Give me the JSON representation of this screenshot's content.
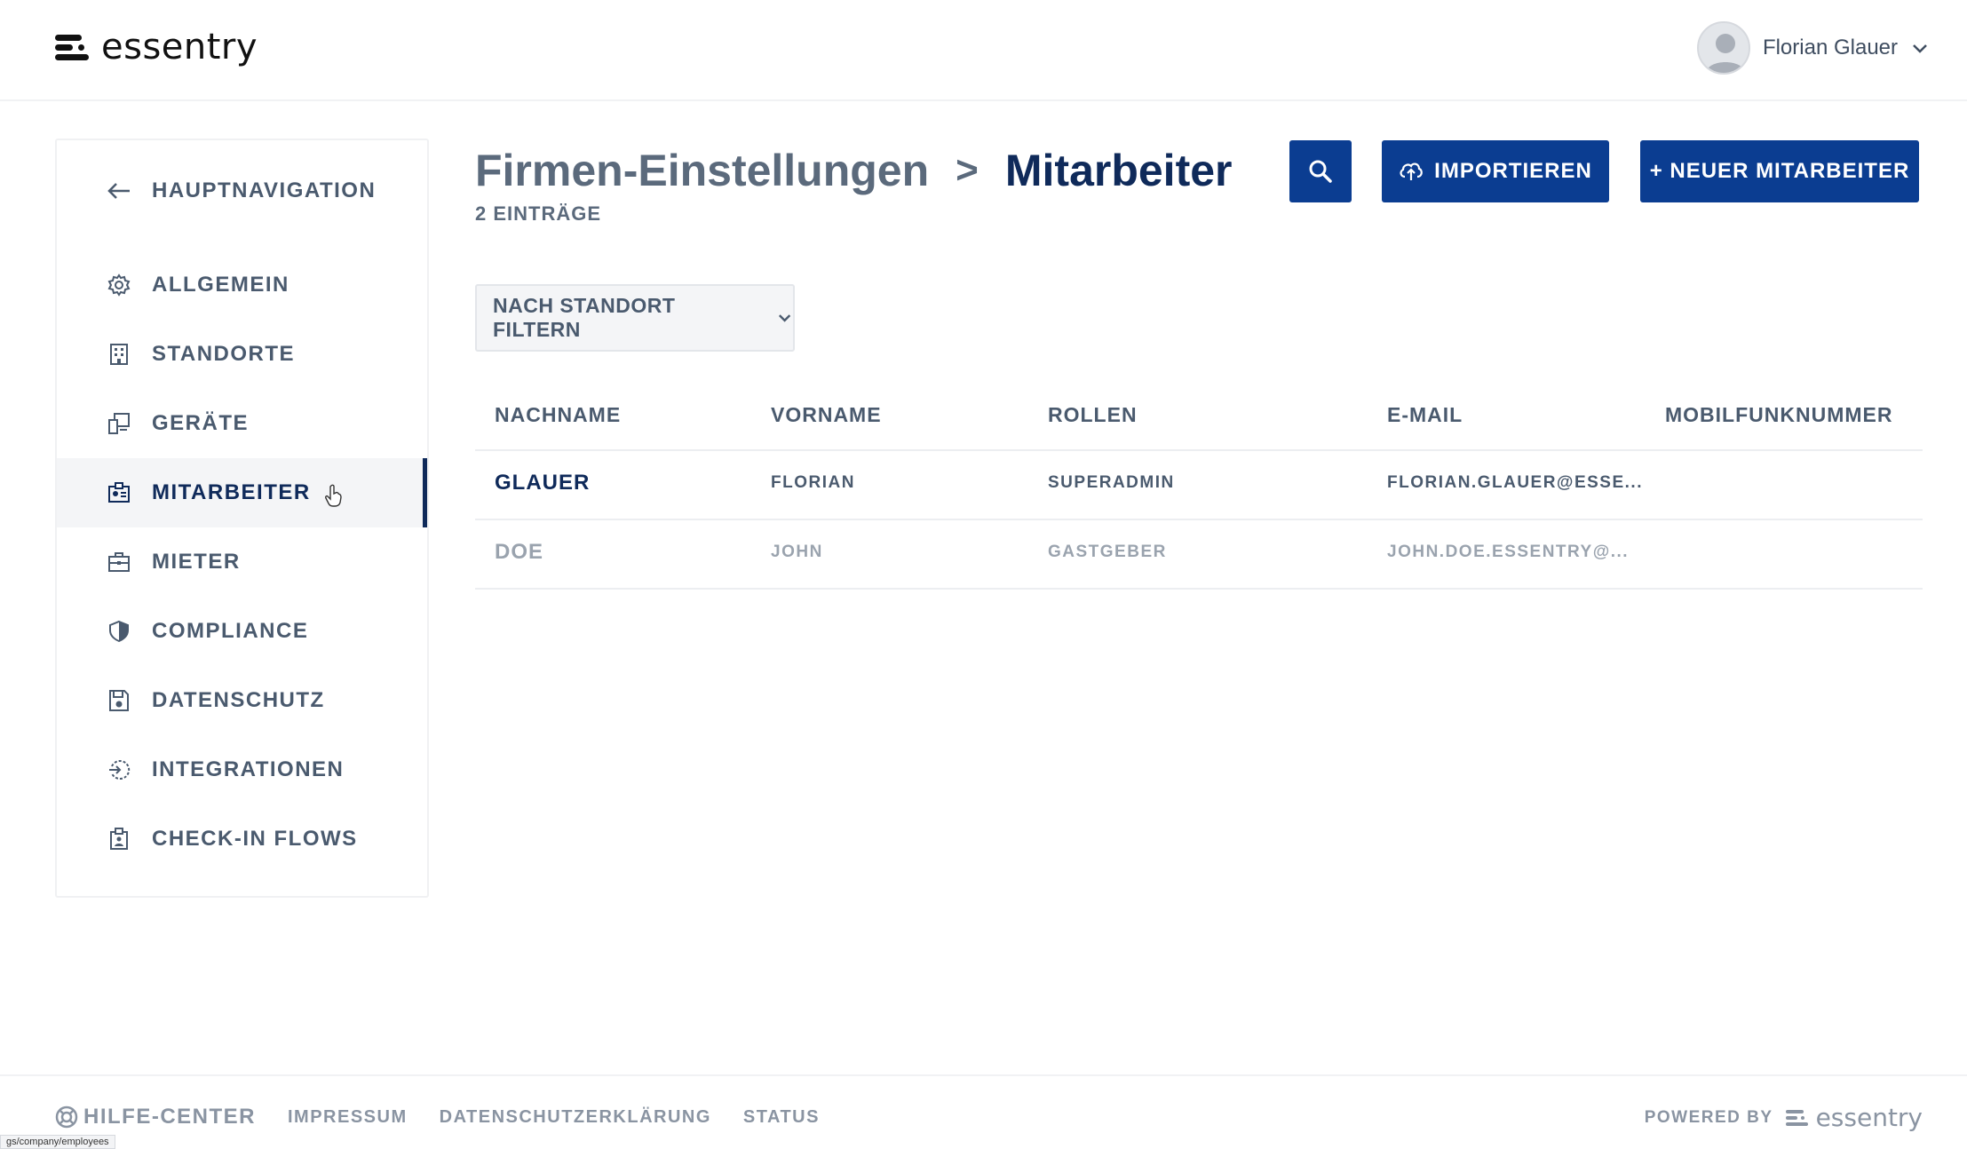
{
  "header": {
    "logo_text": "essentry",
    "user_name": "Florian Glauer"
  },
  "sidebar": {
    "back_label": "HAUPTNAVIGATION",
    "items": [
      {
        "label": "ALLGEMEIN",
        "icon": "gear-icon"
      },
      {
        "label": "STANDORTE",
        "icon": "building-icon"
      },
      {
        "label": "GERÄTE",
        "icon": "devices-icon"
      },
      {
        "label": "MITARBEITER",
        "icon": "employee-badge-icon",
        "active": true
      },
      {
        "label": "MIETER",
        "icon": "briefcase-icon"
      },
      {
        "label": "COMPLIANCE",
        "icon": "shield-icon"
      },
      {
        "label": "DATENSCHUTZ",
        "icon": "save-icon"
      },
      {
        "label": "INTEGRATIONEN",
        "icon": "integration-icon"
      },
      {
        "label": "CHECK-IN FLOWS",
        "icon": "clipboard-icon"
      }
    ]
  },
  "main": {
    "title_parent": "Firmen-Einstellungen",
    "title_separator": ">",
    "title_current": "Mitarbeiter",
    "subtitle": "2 EINTRÄGE",
    "import_label": "IMPORTIEREN",
    "new_label": "+ NEUER MITARBEITER",
    "filter_label": "NACH STANDORT FILTERN"
  },
  "table": {
    "columns": [
      "NACHNAME",
      "VORNAME",
      "ROLLEN",
      "E-MAIL",
      "MOBILFUNKNUMMER"
    ],
    "rows": [
      {
        "nachname": "GLAUER",
        "vorname": "FLORIAN",
        "rollen": "SUPERADMIN",
        "email": "FLORIAN.GLAUER@ESSE...",
        "mobil": ""
      },
      {
        "nachname": "DOE",
        "vorname": "JOHN",
        "rollen": "GASTGEBER",
        "email": "JOHN.DOE.ESSENTRY@...",
        "mobil": ""
      }
    ]
  },
  "footer": {
    "help": "HILFE-CENTER",
    "impressum": "IMPRESSUM",
    "datenschutz": "DATENSCHUTZERKLÄRUNG",
    "status": "STATUS",
    "powered_by": "POWERED BY",
    "powered_logo": "essentry"
  },
  "status_bar_url": "gs/company/employees",
  "colors": {
    "primary": "#0b3d91",
    "navy": "#0f2a5a",
    "muted": "#5b6a7c"
  }
}
